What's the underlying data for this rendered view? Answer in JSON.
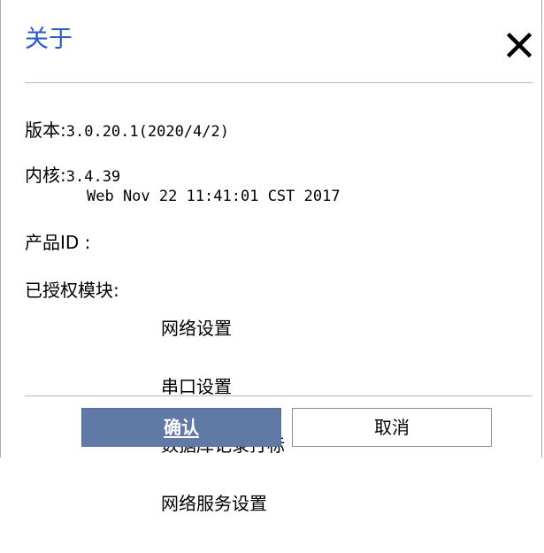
{
  "dialog": {
    "title": "关于",
    "close_symbol": "✕"
  },
  "info": {
    "version_label": "版本:",
    "version_value": "3.0.20.1(2020/4/2)",
    "kernel_label": "内核:",
    "kernel_value": "3.4.39",
    "kernel_build": "Web Nov 22 11:41:01 CST 2017",
    "product_label": "产品ID :",
    "product_value": "",
    "modules_label": "已授权模块:",
    "modules": [
      "网络设置",
      "串口设置",
      "数据库记录打标",
      "网络服务设置"
    ]
  },
  "buttons": {
    "ok_label": "确认",
    "cancel_label": "取消"
  },
  "icons": {
    "close": "close-icon"
  },
  "colors": {
    "title": "#2c58c8",
    "ok_button": "#6079a6"
  }
}
